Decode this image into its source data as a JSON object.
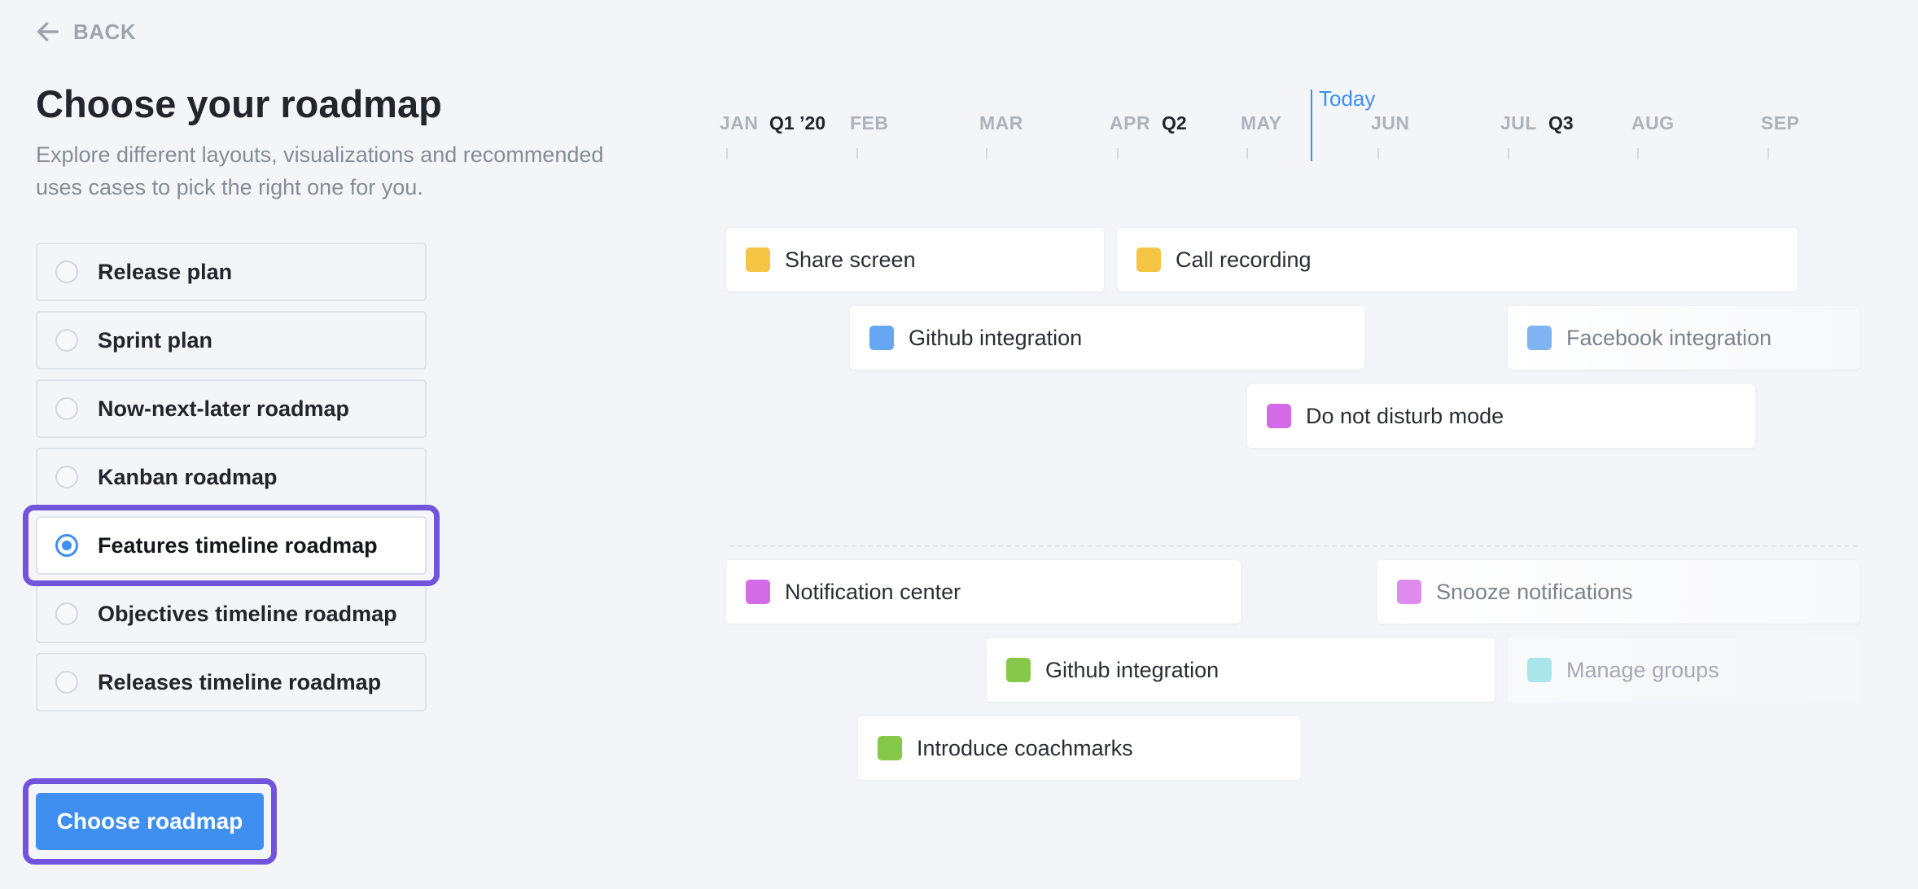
{
  "back": {
    "label": "BACK"
  },
  "header": {
    "title": "Choose your roadmap",
    "subtitle": "Explore different layouts, visualizations and recommended uses cases to pick the right one for you."
  },
  "options": [
    {
      "label": "Release plan",
      "selected": false
    },
    {
      "label": "Sprint plan",
      "selected": false
    },
    {
      "label": "Now-next-later roadmap",
      "selected": false
    },
    {
      "label": "Kanban roadmap",
      "selected": false
    },
    {
      "label": "Features timeline roadmap",
      "selected": true
    },
    {
      "label": "Objectives timeline roadmap",
      "selected": false
    },
    {
      "label": "Releases timeline roadmap",
      "selected": false
    }
  ],
  "cta": {
    "label": "Choose roadmap"
  },
  "timeline": {
    "months": [
      "JAN",
      "FEB",
      "MAR",
      "APR",
      "MAY",
      "JUN",
      "JUL",
      "AUG",
      "SEP"
    ],
    "quarters": [
      "Q1 ’20",
      "Q2",
      "Q3"
    ],
    "today_label": "Today",
    "bars": [
      {
        "label": "Share screen",
        "color": "#f7c544"
      },
      {
        "label": "Call recording",
        "color": "#f7c544"
      },
      {
        "label": "Github integration",
        "color": "#66a6f2"
      },
      {
        "label": "Facebook integration",
        "color": "#7fb3f2"
      },
      {
        "label": "Do not disturb mode",
        "color": "#d46ae8"
      },
      {
        "label": "Notification center",
        "color": "#d46ae8"
      },
      {
        "label": "Snooze notifications",
        "color": "#dd8bec"
      },
      {
        "label": "Github integration",
        "color": "#86c94a"
      },
      {
        "label": "Manage groups",
        "color": "#a8e6ec"
      },
      {
        "label": "Introduce coachmarks",
        "color": "#86c94a"
      }
    ]
  }
}
